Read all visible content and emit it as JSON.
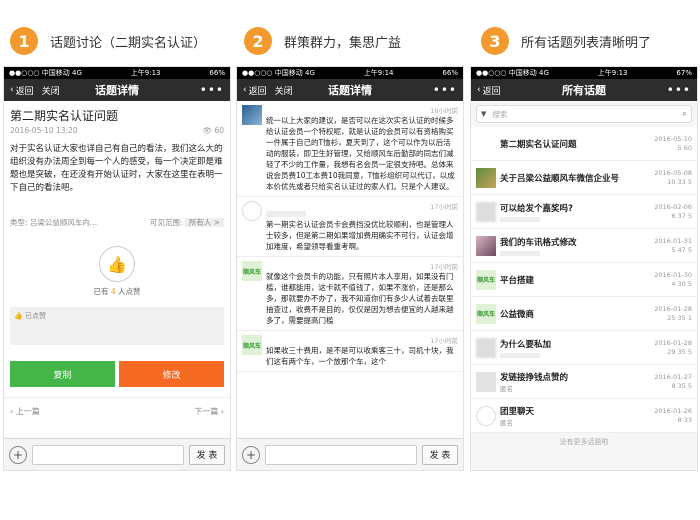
{
  "steps": [
    {
      "num": "1",
      "caption": "话题讨论（二期实名认证）"
    },
    {
      "num": "2",
      "caption": "群策群力，集思广益"
    },
    {
      "num": "3",
      "caption": "所有话题列表清晰明了"
    }
  ],
  "phones": [
    {
      "status": {
        "carrier": "●●○○○ 中国移动  4G",
        "time": "上午9:13",
        "battery": "66%"
      },
      "nav": {
        "back": "返回",
        "close": "关闭",
        "title": "话题详情",
        "more": "•••"
      },
      "topic": {
        "title": "第二期实名认证问题",
        "date": "2016-05-10 13:20",
        "views": "60",
        "body": "对于实名认证大家也详自己有自己的看法，我们这么大的组织没有办法周全到每一个人的感受，每一个决定即是难题也是突破，在还没有开始认证时，大家在这里在表明一下自己的看法吧。",
        "type_label": "类型:",
        "type_value": "吕梁公益顺风车内...",
        "visible_label": "可见范围:",
        "visible_value": "所有人 >",
        "like_prefix": "已有",
        "like_count": "4",
        "like_suffix": "人点赞",
        "liked_label": "已点赞",
        "copy": "复制",
        "edit": "修改",
        "prev": "上一篇",
        "next": "下一篇"
      },
      "toolbar": {
        "send": "发 表"
      }
    },
    {
      "status": {
        "carrier": "●●○○○ 中国移动  4G",
        "time": "上午9:14",
        "battery": "66%"
      },
      "nav": {
        "back": "返回",
        "close": "关闭",
        "title": "话题详情",
        "more": "•••"
      },
      "messages": [
        {
          "time": "16小时前",
          "text": "统一以上大家的建议，是否可以在这次实名认证的时候多给认证会员一个特权呢，就是认证的会员可以有资格购买一件属于自己的T恤衫，夏天到了，这个可以作为以后活动的服装，即卫生好管理，又给顺风车后勤部的同志们减轻了不少的工作量，我想有名会员一定很支持吧。总体来说会员费10工本费10我同意，T恤衫组织可以代订，以成本价优先或者只给实名认证过的家人们。只是个人建议。"
        },
        {
          "time": "17小时前",
          "text": "第一期实名认证会员卡会费挡没优比较顺利，也是管理人士较多，但是第二期如果增加费用确实不可行，认证会增加难度，希望领导看重考啊。"
        },
        {
          "time": "17小时前",
          "text": "就像这个会员卡的功能，只有照片本人享用，如果没有门槛，谁都能用，这卡就不值钱了，如果不涨价，还是那么多，那就要办不办了，我不知道你们有多少人试着去联里抽查过，收费不是目的，仅仅是因为想去便宜的人越来越多了，需要提高门槛"
        },
        {
          "time": "17小时前",
          "text": "如果收三十费用，是不是可以收乘客三十，司机十块，我们这有两个车，一个放那个车，这个"
        }
      ],
      "toolbar": {
        "send": "发 表"
      }
    },
    {
      "status": {
        "carrier": "●●○○○ 中国移动  4G",
        "time": "上午9:13",
        "battery": "67%"
      },
      "nav": {
        "back": "返回",
        "title": "所有话题",
        "more": "•••"
      },
      "search_placeholder": "搜索",
      "topics": [
        {
          "title": "第二期实名认证问题",
          "date": "2016-05-10",
          "stats": "5  60"
        },
        {
          "title": "关于吕梁公益顺风车微信企业号",
          "date": "2016-05-08",
          "stats": "10  33  5"
        },
        {
          "title": "可以给发个嘉奖吗?",
          "date": "2016-02-06",
          "stats": "6  37  5"
        },
        {
          "title": "我们的车讯格式修改",
          "date": "2016-01-31",
          "stats": "5  47  5"
        },
        {
          "title": "平台搭建",
          "date": "2016-01-30",
          "stats": "4  30  5"
        },
        {
          "title": "公益微商",
          "date": "2016-01-28",
          "stats": "25  35  1"
        },
        {
          "title": "为什么要私加",
          "date": "2016-01-28",
          "stats": "29  35  5"
        },
        {
          "title": "发链接挣钱点赞的",
          "sub": "匿名",
          "date": "2016-01-27",
          "stats": "8  35  5"
        },
        {
          "title": "团里聊天",
          "sub": "匿名",
          "date": "2016-01-26",
          "stats": "8  33"
        }
      ],
      "footer": "没有更多话题啦"
    }
  ]
}
